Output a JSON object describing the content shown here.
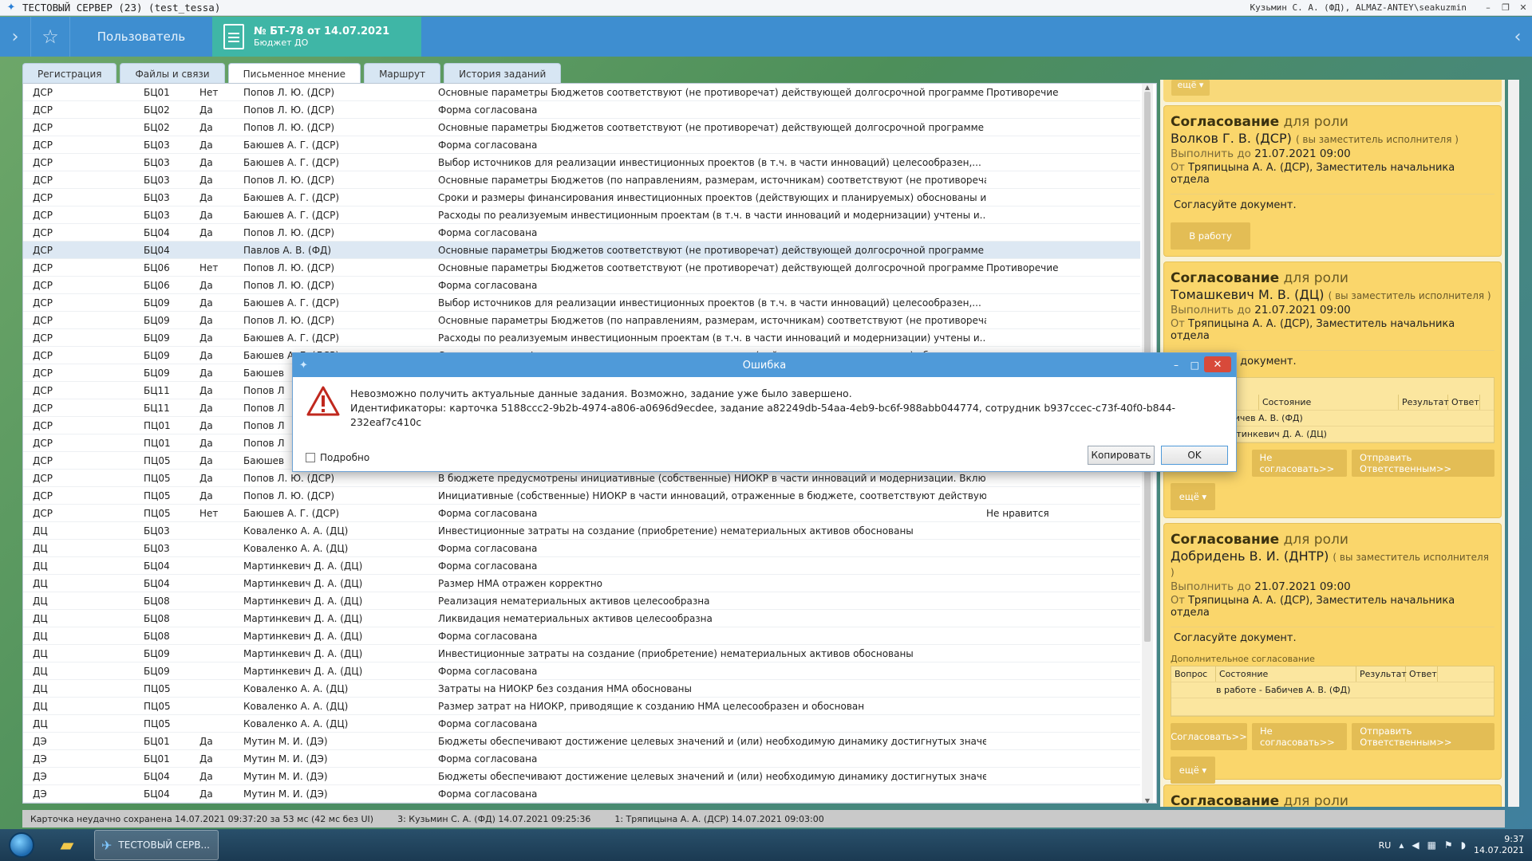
{
  "window": {
    "title": "ТЕСТОВЫЙ СЕРВЕР (23) (test_tessa)",
    "user": "Кузьмин С. А. (ФД), ALMAZ-ANTEY\\seakuzmin",
    "minimize": "–",
    "maximize": "❐",
    "close": "✕"
  },
  "nav": {
    "left_arrow": "›",
    "star": "☆",
    "user_tab": "Пользователь",
    "doc_title": "№ БТ-78 от 14.07.2021",
    "doc_subtitle": "Бюджет ДО",
    "right_arrow": "‹"
  },
  "tabs": [
    "Регистрация",
    "Файлы и связи",
    "Письменное мнение",
    "Маршрут",
    "История заданий"
  ],
  "rows": [
    [
      "ДСР",
      "БЦ01",
      "Нет",
      "Попов Л. Ю. (ДСР)",
      "Основные параметры Бюджетов соответствуют (не противоречат) действующей долгосрочной программе ра...",
      "Противоречие"
    ],
    [
      "ДСР",
      "БЦ02",
      "Да",
      "Попов Л. Ю. (ДСР)",
      "Форма согласована",
      ""
    ],
    [
      "ДСР",
      "БЦ02",
      "Да",
      "Попов Л. Ю. (ДСР)",
      "Основные параметры Бюджетов соответствуют (не противоречат) действующей долгосрочной программе ра...",
      ""
    ],
    [
      "ДСР",
      "БЦ03",
      "Да",
      "Баюшев А. Г. (ДСР)",
      "Форма согласована",
      ""
    ],
    [
      "ДСР",
      "БЦ03",
      "Да",
      "Баюшев А. Г. (ДСР)",
      "Выбор источников для реализации инвестиционных проектов (в т.ч. в части инноваций) целесообразен,...",
      ""
    ],
    [
      "ДСР",
      "БЦ03",
      "Да",
      "Попов Л. Ю. (ДСР)",
      "Основные параметры Бюджетов (по направлениям, размерам, источникам) соответствуют (не противореча...",
      ""
    ],
    [
      "ДСР",
      "БЦ03",
      "Да",
      "Баюшев А. Г. (ДСР)",
      "Сроки  и размеры финансирования инвестиционных проектов (действующих и планируемых) обоснованы и ...",
      ""
    ],
    [
      "ДСР",
      "БЦ03",
      "Да",
      "Баюшев А. Г. (ДСР)",
      "Расходы по реализуемым инвестиционным проектам (в т.ч. в части инноваций и модернизации) учтены и...",
      ""
    ],
    [
      "ДСР",
      "БЦ04",
      "Да",
      "Попов Л. Ю. (ДСР)",
      "Форма согласована",
      ""
    ],
    [
      "ДСР",
      "БЦ04",
      "",
      "Павлов А. В. (ФД)",
      "Основные параметры Бюджетов соответствуют (не противоречат) действующей долгосрочной программе ра...",
      ""
    ],
    [
      "ДСР",
      "БЦ06",
      "Нет",
      "Попов Л. Ю. (ДСР)",
      "Основные параметры Бюджетов соответствуют (не противоречат) действующей долгосрочной программе ра...",
      "Противоречие"
    ],
    [
      "ДСР",
      "БЦ06",
      "Да",
      "Попов Л. Ю. (ДСР)",
      "Форма согласована",
      ""
    ],
    [
      "ДСР",
      "БЦ09",
      "Да",
      "Баюшев А. Г. (ДСР)",
      "Выбор источников для реализации инвестиционных проектов (в т.ч. в части инноваций) целесообразен,...",
      ""
    ],
    [
      "ДСР",
      "БЦ09",
      "Да",
      "Попов Л. Ю. (ДСР)",
      "Основные параметры Бюджетов (по направлениям, размерам, источникам) соответствуют (не противореча...",
      ""
    ],
    [
      "ДСР",
      "БЦ09",
      "Да",
      "Баюшев А. Г. (ДСР)",
      "Расходы по реализуемым инвестиционным проектам (в т.ч. в части инноваций и модернизации) учтены и...",
      ""
    ],
    [
      "ДСР",
      "БЦ09",
      "Да",
      "Баюшев А. Г. (ДСР)",
      "Сроки  и размеры финансирования инвестиционных проектов (действующих и планируемых) обоснованы и ...",
      ""
    ],
    [
      "ДСР",
      "БЦ09",
      "Да",
      "Баюшев",
      "",
      ""
    ],
    [
      "ДСР",
      "БЦ11",
      "Да",
      "Попов Л",
      "",
      ""
    ],
    [
      "ДСР",
      "БЦ11",
      "Да",
      "Попов Л",
      "",
      ""
    ],
    [
      "ДСР",
      "ПЦ01",
      "Да",
      "Попов Л",
      "",
      ""
    ],
    [
      "ДСР",
      "ПЦ01",
      "Да",
      "Попов Л",
      "",
      ""
    ],
    [
      "ДСР",
      "ПЦ05",
      "Да",
      "Баюшев",
      "",
      ""
    ],
    [
      "ДСР",
      "ПЦ05",
      "Да",
      "Попов Л. Ю. (ДСР)",
      "В бюджете предусмотрены инициативные (собственные) НИОКР в части инноваций и модернизации. Включ...",
      ""
    ],
    [
      "ДСР",
      "ПЦ05",
      "Да",
      "Попов Л. Ю. (ДСР)",
      "Инициативные (собственные) НИОКР в части инноваций, отраженные в бюджете, соответствуют действующ...",
      ""
    ],
    [
      "ДСР",
      "ПЦ05",
      "Нет",
      "Баюшев А. Г. (ДСР)",
      "Форма согласована",
      "Не нравится"
    ],
    [
      "ДЦ",
      "БЦ03",
      "",
      "Коваленко А. А. (ДЦ)",
      "Инвестиционные затраты на создание (приобретение) нематериальных активов обоснованы",
      ""
    ],
    [
      "ДЦ",
      "БЦ03",
      "",
      "Коваленко А. А. (ДЦ)",
      "Форма согласована",
      ""
    ],
    [
      "ДЦ",
      "БЦ04",
      "",
      "Мартинкевич Д. А. (ДЦ)",
      "Форма согласована",
      ""
    ],
    [
      "ДЦ",
      "БЦ04",
      "",
      "Мартинкевич Д. А. (ДЦ)",
      "Размер НМА отражен корректно",
      ""
    ],
    [
      "ДЦ",
      "БЦ08",
      "",
      "Мартинкевич Д. А. (ДЦ)",
      "Реализация нематериальных активов целесообразна",
      ""
    ],
    [
      "ДЦ",
      "БЦ08",
      "",
      "Мартинкевич Д. А. (ДЦ)",
      "Ликвидация нематериальных активов целесообразна",
      ""
    ],
    [
      "ДЦ",
      "БЦ08",
      "",
      "Мартинкевич Д. А. (ДЦ)",
      "Форма согласована",
      ""
    ],
    [
      "ДЦ",
      "БЦ09",
      "",
      "Мартинкевич Д. А. (ДЦ)",
      "Инвестиционные затраты на создание (приобретение) нематериальных активов обоснованы",
      ""
    ],
    [
      "ДЦ",
      "БЦ09",
      "",
      "Мартинкевич Д. А. (ДЦ)",
      "Форма согласована",
      ""
    ],
    [
      "ДЦ",
      "ПЦ05",
      "",
      "Коваленко А. А. (ДЦ)",
      "Затраты на НИОКР без создания НМА  обоснованы",
      ""
    ],
    [
      "ДЦ",
      "ПЦ05",
      "",
      "Коваленко А. А. (ДЦ)",
      "Размер затрат на НИОКР, приводящие к созданию НМА целесообразен и обоснован",
      ""
    ],
    [
      "ДЦ",
      "ПЦ05",
      "",
      "Коваленко А. А. (ДЦ)",
      "Форма согласована",
      ""
    ],
    [
      "ДЭ",
      "БЦ01",
      "Да",
      "Мутин М. И. (ДЭ)",
      "Бюджеты обеспечивают достижение целевых значений  и (или) необходимую динамику достигнутых значен...",
      ""
    ],
    [
      "ДЭ",
      "БЦ01",
      "Да",
      "Мутин М. И. (ДЭ)",
      "Форма согласована",
      ""
    ],
    [
      "ДЭ",
      "БЦ04",
      "Да",
      "Мутин М. И. (ДЭ)",
      "Бюджеты обеспечивают достижение целевых значений  и (или) необходимую динамику достигнутых значен...",
      ""
    ],
    [
      "ДЭ",
      "БЦ04",
      "Да",
      "Мутин М. И. (ДЭ)",
      "Форма согласована",
      ""
    ]
  ],
  "tasks": {
    "top_more": "ещё ▾",
    "card1": {
      "h_prefix": "Согласование",
      "h_role": "для роли",
      "person": "Волков Г. В. (ДСР)",
      "deputy": "( вы заместитель исполнителя )",
      "due_label": "Выполнить до",
      "due_value": "21.07.2021 09:00",
      "from_label": "От",
      "from_value": "Тряпицына А. А. (ДСР), Заместитель начальника отдела",
      "body": "Согласуйте документ.",
      "btn": "В работу"
    },
    "card2": {
      "h_prefix": "Согласование",
      "h_role": "для роли",
      "person": "Томашкевич М. В. (ДЦ)",
      "deputy": "( вы заместитель исполнителя )",
      "due_label": "Выполнить до",
      "due_value": "21.07.2021 09:00",
      "from_label": "От",
      "from_value": "Тряпицына А. А. (ДСР), Заместитель начальника отдела",
      "body": "Согласуйте документ.",
      "sub_caption": "согласование",
      "col_state": "Состояние",
      "col_result": "Результат",
      "col_answer": "Ответ",
      "row1": "боте - Бабичев А. В. (ФД)",
      "row2": "чено - Мартинкевич Д. А. (ДЦ)",
      "btn_reject": "Не согласовать>>",
      "btn_send": "Отправить Ответственным>>",
      "btn_more": "ещё ▾"
    },
    "card3": {
      "h_prefix": "Согласование",
      "h_role": "для роли",
      "person": "Добридень В. И. (ДНТР)",
      "deputy": "( вы заместитель исполнителя )",
      "due_label": "Выполнить до",
      "due_value": "21.07.2021 09:00",
      "from_label": "От",
      "from_value": "Тряпицына А. А. (ДСР), Заместитель начальника отдела",
      "body": "Согласуйте документ.",
      "sub_caption": "Дополнительное согласование",
      "col_question": "Вопрос",
      "col_state": "Состояние",
      "col_result": "Результат",
      "col_answer": "Ответ",
      "row1": "в работе - Бабичев А. В. (ФД)",
      "btn_approve": "Согласовать>>",
      "btn_reject": "Не согласовать>>",
      "btn_send": "Отправить Ответственным>>",
      "btn_more": "ещё ▾"
    },
    "card4": {
      "h_prefix": "Согласование",
      "h_role": "для роли"
    }
  },
  "status": {
    "saved": "Карточка неудачно сохранена 14.07.2021 09:37:20 за 53 мс (42 мс без UI)",
    "s2": "3:  Кузьмин С. А. (ФД)  14.07.2021 09:25:36",
    "s3": "1:  Тряпицына А. А. (ДСР)  14.07.2021 09:03:00"
  },
  "taskbar": {
    "app": "ТЕСТОВЫЙ СЕРВ...",
    "lang": "RU",
    "time": "9:37",
    "date": "14.07.2021"
  },
  "dialog": {
    "title": "Ошибка",
    "line1": "Невозможно получить актуальные данные задания. Возможно, задание уже было завершено.",
    "line2": "Идентификаторы: карточка 5188ccc2-9b2b-4974-a806-a0696d9ecdee, задание a82249db-54aa-4eb9-bc6f-988abb044774, сотрудник b937ccec-c73f-40f0-b844-232eaf7c410c",
    "checkbox": "Подробно",
    "copy": "Копировать",
    "ok": "OK",
    "min": "–",
    "max": "□",
    "close": "✕"
  },
  "colors": {
    "accent": "#3e8ed0",
    "doc_tab": "#3fb6a6",
    "task_card": "#fad66b",
    "dialog_title": "#4f9ad9"
  }
}
